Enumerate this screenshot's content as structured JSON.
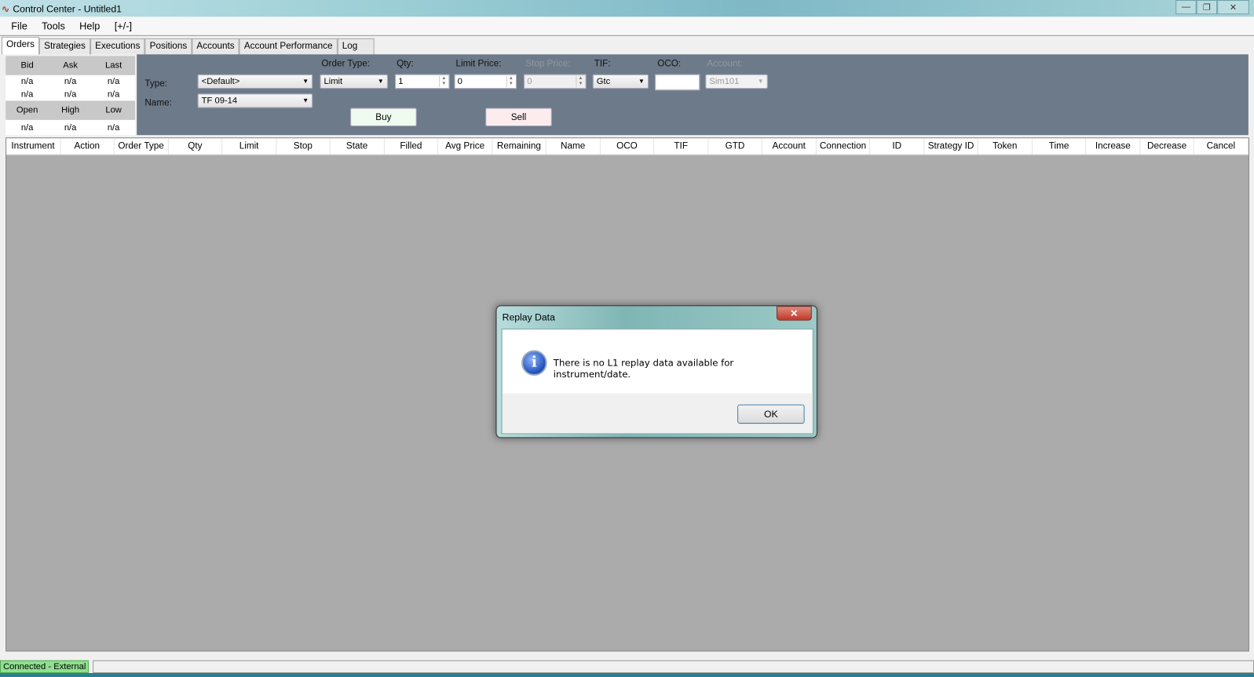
{
  "window": {
    "title": "Control Center - Untitled1",
    "minimize": "—",
    "restore": "❐",
    "close": "✕"
  },
  "menu": [
    "File",
    "Tools",
    "Help",
    "[+/-]"
  ],
  "tabs": [
    "Orders",
    "Strategies",
    "Executions",
    "Positions",
    "Accounts",
    "Account Performance",
    "Log"
  ],
  "quote": {
    "headers1": [
      "Bid",
      "Ask",
      "Last"
    ],
    "row1": [
      "n/a",
      "n/a",
      "n/a"
    ],
    "row2": [
      "n/a",
      "n/a",
      "n/a"
    ],
    "headers2": [
      "Open",
      "High",
      "Low"
    ],
    "row3": [
      "n/a",
      "n/a",
      "n/a"
    ]
  },
  "entry": {
    "type_label": "Type:",
    "type_value": "<Default>",
    "name_label": "Name:",
    "name_value": "TF 09-14",
    "order_type_label": "Order Type:",
    "order_type_value": "Limit",
    "qty_label": "Qty:",
    "qty_value": "1",
    "limit_label": "Limit Price:",
    "limit_value": "0",
    "stop_label": "Stop Price:",
    "stop_value": "0",
    "tif_label": "TIF:",
    "tif_value": "Gtc",
    "oco_label": "OCO:",
    "oco_value": "",
    "account_label": "Account:",
    "account_value": "Sim101",
    "buy": "Buy",
    "sell": "Sell"
  },
  "columns": [
    "Instrument",
    "Action",
    "Order Type",
    "Qty",
    "Limit",
    "Stop",
    "State",
    "Filled",
    "Avg Price",
    "Remaining",
    "Name",
    "OCO",
    "TIF",
    "GTD",
    "Account",
    "Connection",
    "ID",
    "Strategy ID",
    "Token",
    "Time",
    "Increase",
    "Decrease",
    "Cancel"
  ],
  "status": {
    "connection": "Connected - External"
  },
  "dialog": {
    "title": "Replay Data",
    "close": "✕",
    "icon": "i",
    "message": "There is no L1 replay data available for instrument/date.",
    "ok": "OK"
  }
}
